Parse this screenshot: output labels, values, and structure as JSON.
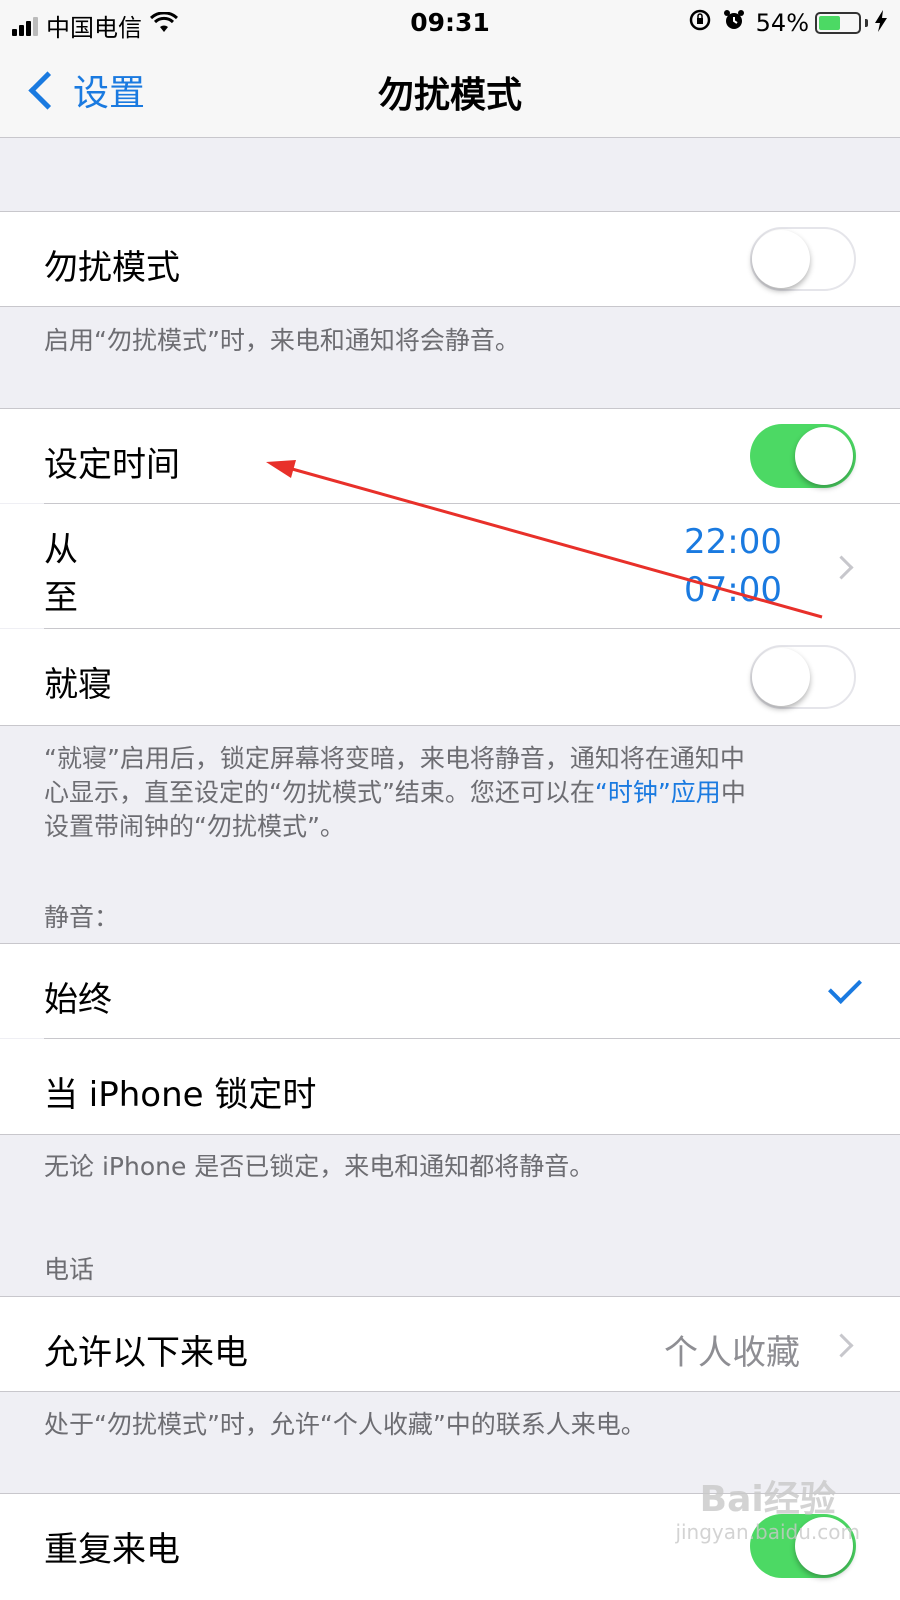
{
  "status_bar": {
    "carrier": "中国电信",
    "time": "09:31",
    "battery_percent": "54%",
    "battery_level": 0.54,
    "icons": [
      "signal-icon",
      "wifi-icon",
      "orientation-lock-icon",
      "alarm-icon",
      "battery-icon",
      "charging-icon"
    ]
  },
  "nav": {
    "back_label": "设置",
    "title": "勿扰模式"
  },
  "dnd": {
    "label": "勿扰模式",
    "enabled": false,
    "footer": "启用“勿扰模式”时，来电和通知将会静音。"
  },
  "scheduled": {
    "label": "设定时间",
    "enabled": true,
    "from_label": "从",
    "to_label": "至",
    "from_time": "22:00",
    "to_time": "07:00"
  },
  "bedtime": {
    "label": "就寝",
    "enabled": false,
    "footer_line1": "“就寝”启用后，锁定屏幕将变暗，来电将静音，通知将在通知中",
    "footer_line2_a": "心显示，直至设定的“勿扰模式”结束。您还可以在",
    "footer_line2_link": "“时钟”应用",
    "footer_line2_b": "中",
    "footer_line3": "设置带闹钟的“勿扰模式”。"
  },
  "silence": {
    "header": "静音：",
    "always_label": "始终",
    "locked_label": "当 iPhone 锁定时",
    "selected": "always",
    "footer": "无论 iPhone 是否已锁定，来电和通知都将静音。"
  },
  "phone": {
    "header": "电话",
    "allow_calls_label": "允许以下来电",
    "allow_calls_value": "个人收藏",
    "footer": "处于“勿扰模式”时，允许“个人收藏”中的联系人来电。",
    "repeated_calls_label": "重复来电",
    "repeated_calls_enabled": true
  },
  "watermark": {
    "brand": "Bai经验",
    "url": "jingyan.baidu.com"
  },
  "colors": {
    "accent": "#1a7ae0",
    "toggle_on": "#4cd964",
    "annotation_arrow": "#e8302a",
    "background": "#efeff4"
  }
}
